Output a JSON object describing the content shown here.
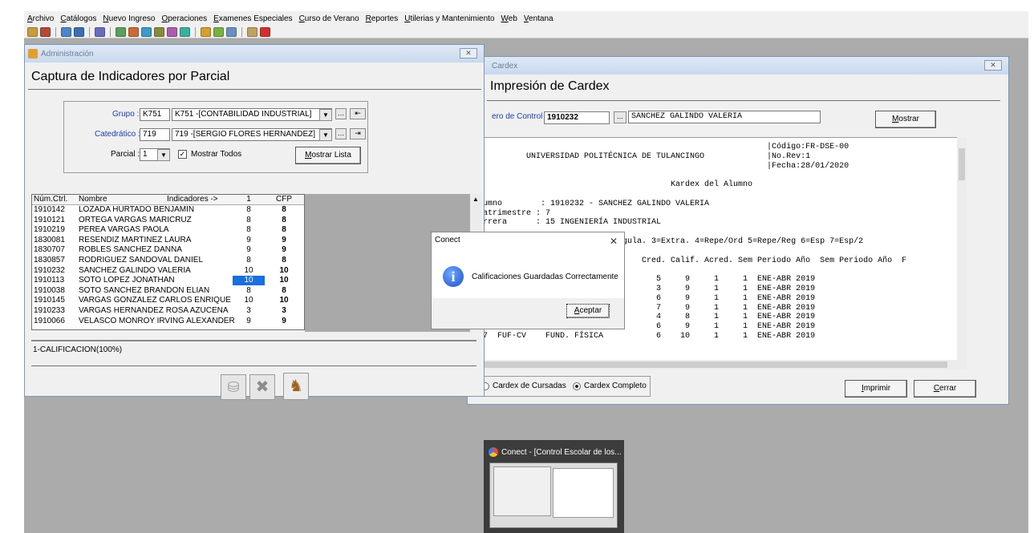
{
  "menu": [
    "Archivo",
    "Catálogos",
    "Nuevo Ingreso",
    "Operaciones",
    "Examenes Especiales",
    "Curso de Verano",
    "Reportes",
    "Utilerias y Mantenimiento",
    "Web",
    "Ventana"
  ],
  "toolbar_icons": [
    "students-icon",
    "teachers-icon",
    "window-icon",
    "window2-icon",
    "edit-icon",
    "users-icon",
    "book-icon",
    "chart-icon",
    "tools-icon",
    "print-icon",
    "settings-icon",
    "group-icon",
    "refresh-icon",
    "report-icon",
    "exit-icon"
  ],
  "admin": {
    "window_title": "Administración",
    "heading": "Captura de Indicadores por Parcial",
    "grupo_label": "Grupo :",
    "grupo_code": "K751",
    "grupo_desc": "K751 -[CONTABILIDAD INDUSTRIAL]",
    "catedratico_label": "Catedrático :",
    "catedratico_code": "719",
    "catedratico_desc": "719 -[SERGIO FLORES HERNANDEZ]",
    "parcial_label": "Parcial :",
    "parcial_value": "1",
    "mostrar_todos_label": "Mostrar Todos",
    "mostrar_todos_checked": true,
    "mostrar_lista_button": "Mostrar Lista",
    "grid": {
      "headers": {
        "ctrl": "Núm.Ctrl.",
        "name": "Nombre",
        "indicators": "Indicadores ->",
        "p1": "1",
        "cfp": "CFP"
      },
      "rows": [
        {
          "ctrl": "1910142",
          "name": "LOZADA HURTADO BENJAMIN",
          "p1": "8",
          "cfp": "8"
        },
        {
          "ctrl": "1910121",
          "name": "ORTEGA VARGAS MARICRUZ",
          "p1": "8",
          "cfp": "8"
        },
        {
          "ctrl": "1910219",
          "name": "PEREA VARGAS PAOLA",
          "p1": "8",
          "cfp": "8"
        },
        {
          "ctrl": "1830081",
          "name": "RESENDIZ MARTINEZ LAURA",
          "p1": "9",
          "cfp": "9"
        },
        {
          "ctrl": "1830707",
          "name": "ROBLES SANCHEZ DANNA",
          "p1": "9",
          "cfp": "9"
        },
        {
          "ctrl": "1830857",
          "name": "RODRIGUEZ SANDOVAL DANIEL",
          "p1": "8",
          "cfp": "8"
        },
        {
          "ctrl": "1910232",
          "name": "SANCHEZ GALINDO VALERIA",
          "p1": "10",
          "cfp": "10"
        },
        {
          "ctrl": "1910113",
          "name": "SOTO LOPEZ JONATHAN",
          "p1": "10",
          "cfp": "10"
        },
        {
          "ctrl": "1910038",
          "name": "SOTO SANCHEZ BRANDON ELIAN",
          "p1": "8",
          "cfp": "8"
        },
        {
          "ctrl": "1910145",
          "name": "VARGAS GONZALEZ CARLOS ENRIQUE",
          "p1": "10",
          "cfp": "10"
        },
        {
          "ctrl": "1910233",
          "name": "VARGAS HERNANDEZ ROSA AZUCENA",
          "p1": "3",
          "cfp": "3"
        },
        {
          "ctrl": "1910066",
          "name": "VELASCO MONROY IRVING ALEXANDER",
          "p1": "9",
          "cfp": "9"
        }
      ]
    },
    "footer_label": "1-CALIFICACION(100%)"
  },
  "cardex": {
    "window_title": "Cardex",
    "heading": "Impresión de Cardex",
    "control_label": "ero de Control",
    "control_value": "1910232",
    "browse_label": "...",
    "student_name": "SANCHEZ GALINDO VALERIA",
    "mostrar_button": "Mostrar",
    "report_lines": [
      "                                                            |Código:FR-DSE-00",
      "          UNIVERSIDAD POLITÉCNICA DE TULANCINGO             |No.Rev:1",
      "                                                            |Fecha:28/01/2020",
      "",
      "                                        Kardex del Alumno",
      "",
      "lumno        : 1910232 - SANCHEZ GALINDO VALERIA",
      "uatrimestre : 7",
      "arrera      : 15 INGENIERÍA INDUSTRIAL",
      "",
      "                 rdinario 2=Regula. 3=Extra. 4=Repe/Ord 5=Repe/Reg 6=Esp 7=Esp/2",
      "",
      "                                  Cred. Calif. Acred. Sem Periodo Año  Sem Periodo Año  F",
      "",
      "                                     5     9     1     1  ENE-ABR 2019",
      "                          ER         3     9     1     1  ENE-ABR 2019",
      "                          L          6     9     1     1  ENE-ABR 2019",
      "                          NT         7     9     1     1  ENE-ABR 2019",
      "15  III-ES    INT. ING. IND.         4     8     1     1  ENE-ABR 2019",
      "16  FUQ-CV    FUND. QUIMICA          6     9     1     1  ENE-ABR 2019",
      "17  FUF-CV    FUND. FÍSICA           6    10     1     1  ENE-ABR 2019"
    ],
    "radio_cursadas": "Cardex de Cursadas",
    "radio_completo": "Cardex Completo",
    "selected_radio": "Cardex Completo",
    "imprimir_button": "Imprimir",
    "cerrar_button": "Cerrar"
  },
  "dialog": {
    "title": "Conect",
    "close_glyph": "✕",
    "message": "Calificaciones Guardadas Correctamente",
    "ok_button": "Aceptar"
  },
  "taskbar_thumb": {
    "title": "Conect - [Control Escolar de los..."
  },
  "colors": {
    "mdi_background": "#ababab",
    "selection": "#1a6ee0",
    "label_blue": "#1a3fb3",
    "title_bar": "#c9d9ee"
  }
}
